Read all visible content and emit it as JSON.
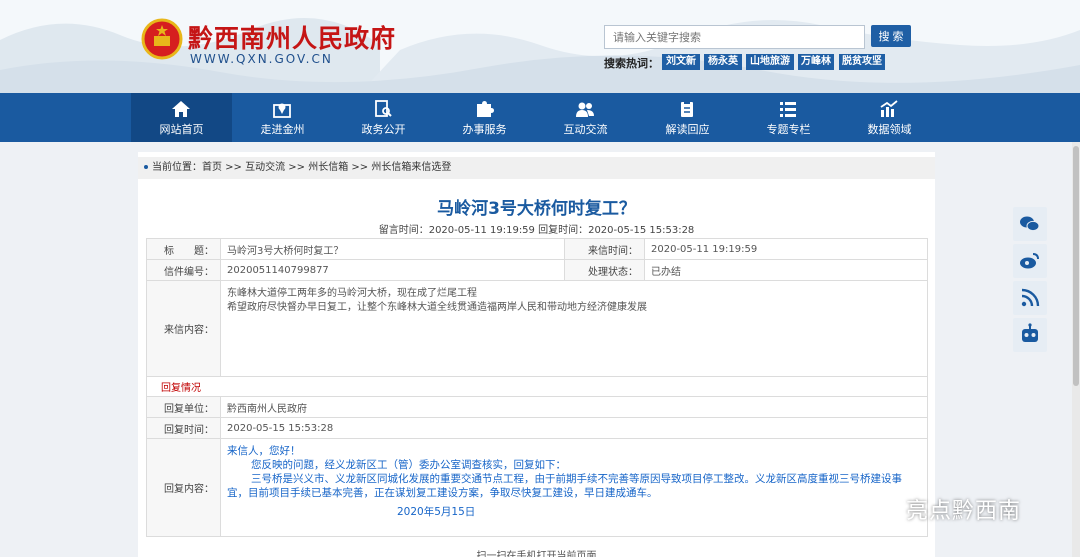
{
  "header": {
    "site_name": "黔西南州人民政府",
    "site_url": "WWW.QXN.GOV.CN",
    "search_placeholder": "请输入关键字搜索",
    "search_button": "搜 索",
    "hot_label": "搜索热词：",
    "hot_words": [
      "刘文新",
      "杨永英",
      "山地旅游",
      "万峰林",
      "脱贫攻坚"
    ]
  },
  "nav": [
    "网站首页",
    "走进金州",
    "政务公开",
    "办事服务",
    "互动交流",
    "解读回应",
    "专题专栏",
    "数据领域"
  ],
  "breadcrumb": "当前位置：首页 >> 互动交流 >> 州长信箱 >> 州长信箱来信选登",
  "letter": {
    "title": "马岭河3号大桥何时复工？",
    "meta": "留言时间：2020-05-11 19:19:59 回复时间：2020-05-15 15:53:28",
    "title_label": "标　　题：",
    "title_value": "马岭河3号大桥何时复工？",
    "received_label": "来信时间：",
    "received_value": "2020-05-11 19:19:59",
    "number_label": "信件编号：",
    "number_value": "2020051140799877",
    "status_label": "处理状态：",
    "status_value": "已办结",
    "content_label": "来信内容：",
    "content_line1": "东峰林大道停工两年多的马岭河大桥，现在成了烂尾工程",
    "content_line2": "希望政府尽快督办早日复工，让整个东峰林大道全线贯通造福两岸人民和带动地方经济健康发展"
  },
  "reply": {
    "section_label": "回复情况",
    "unit_label": "回复单位：",
    "unit_value": "黔西南州人民政府",
    "time_label": "回复时间：",
    "time_value": "2020-05-15 15:53:28",
    "content_label": "回复内容：",
    "greeting": "来信人，您好！",
    "para1": "您反映的问题，经义龙新区工（管）委办公室调查核实，回复如下：",
    "para2": "三号桥是兴义市、义龙新区同城化发展的重要交通节点工程，由于前期手续不完善等原因导致项目停工整改。义龙新区高度重视三号桥建设事宜，目前项目手续已基本完善，正在谋划复工建设方案，争取尽快复工建设，早日建成通车。",
    "date": "2020年5月15日"
  },
  "bottom_note": "扫一扫在手机打开当前页面",
  "watermark": "亮点黔西南",
  "colors": {
    "brand_blue": "#1a5aa0",
    "title_red": "#c51515",
    "reply_blue": "#1765c8"
  }
}
